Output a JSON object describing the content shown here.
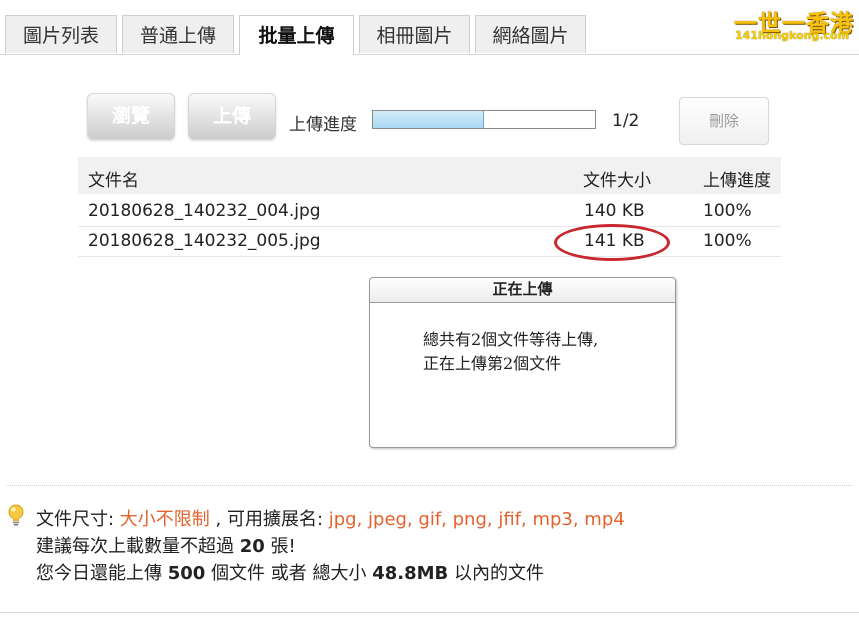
{
  "tabs": [
    {
      "label": "圖片列表",
      "active": false
    },
    {
      "label": "普通上傳",
      "active": false
    },
    {
      "label": "批量上傳",
      "active": true
    },
    {
      "label": "相冊圖片",
      "active": false
    },
    {
      "label": "網絡圖片",
      "active": false
    }
  ],
  "logo": {
    "main": "一世一香港",
    "sub": "141hongkong.com"
  },
  "actions": {
    "browse_label": "瀏覽",
    "upload_label": "上傳",
    "progress_label": "上傳進度",
    "progress_fraction": 0.5,
    "progress_count": "1/2",
    "delete_label": "刪除"
  },
  "table": {
    "headers": {
      "name": "文件名",
      "size": "文件大小",
      "progress": "上傳進度"
    },
    "rows": [
      {
        "name": "20180628_140232_004.jpg",
        "size": "140 KB",
        "progress": "100%"
      },
      {
        "name": "20180628_140232_005.jpg",
        "size": "141 KB",
        "progress": "100%"
      }
    ]
  },
  "dialog": {
    "title": "正在上傳",
    "line1": "總共有2個文件等待上傳,",
    "line2": "正在上傳第2個文件"
  },
  "info": {
    "size_label": "文件尺寸: ",
    "size_value": "大小不限制",
    "ext_label": " , 可用擴展名: ",
    "ext_value": "jpg, jpeg, gif, png, jfif, mp3, mp4",
    "advice_prefix": "建議每次上載數量不超過 ",
    "advice_count": "20",
    "advice_suffix": " 張!",
    "today_prefix": "您今日還能上傳 ",
    "today_count": "500",
    "today_mid": " 個文件 或者 總大小 ",
    "today_size": "48.8MB",
    "today_suffix": " 以內的文件"
  },
  "colors": {
    "highlight": "#e4622c",
    "annotation_circle": "#c8282d",
    "progress_fill": "#a9d8f3"
  }
}
